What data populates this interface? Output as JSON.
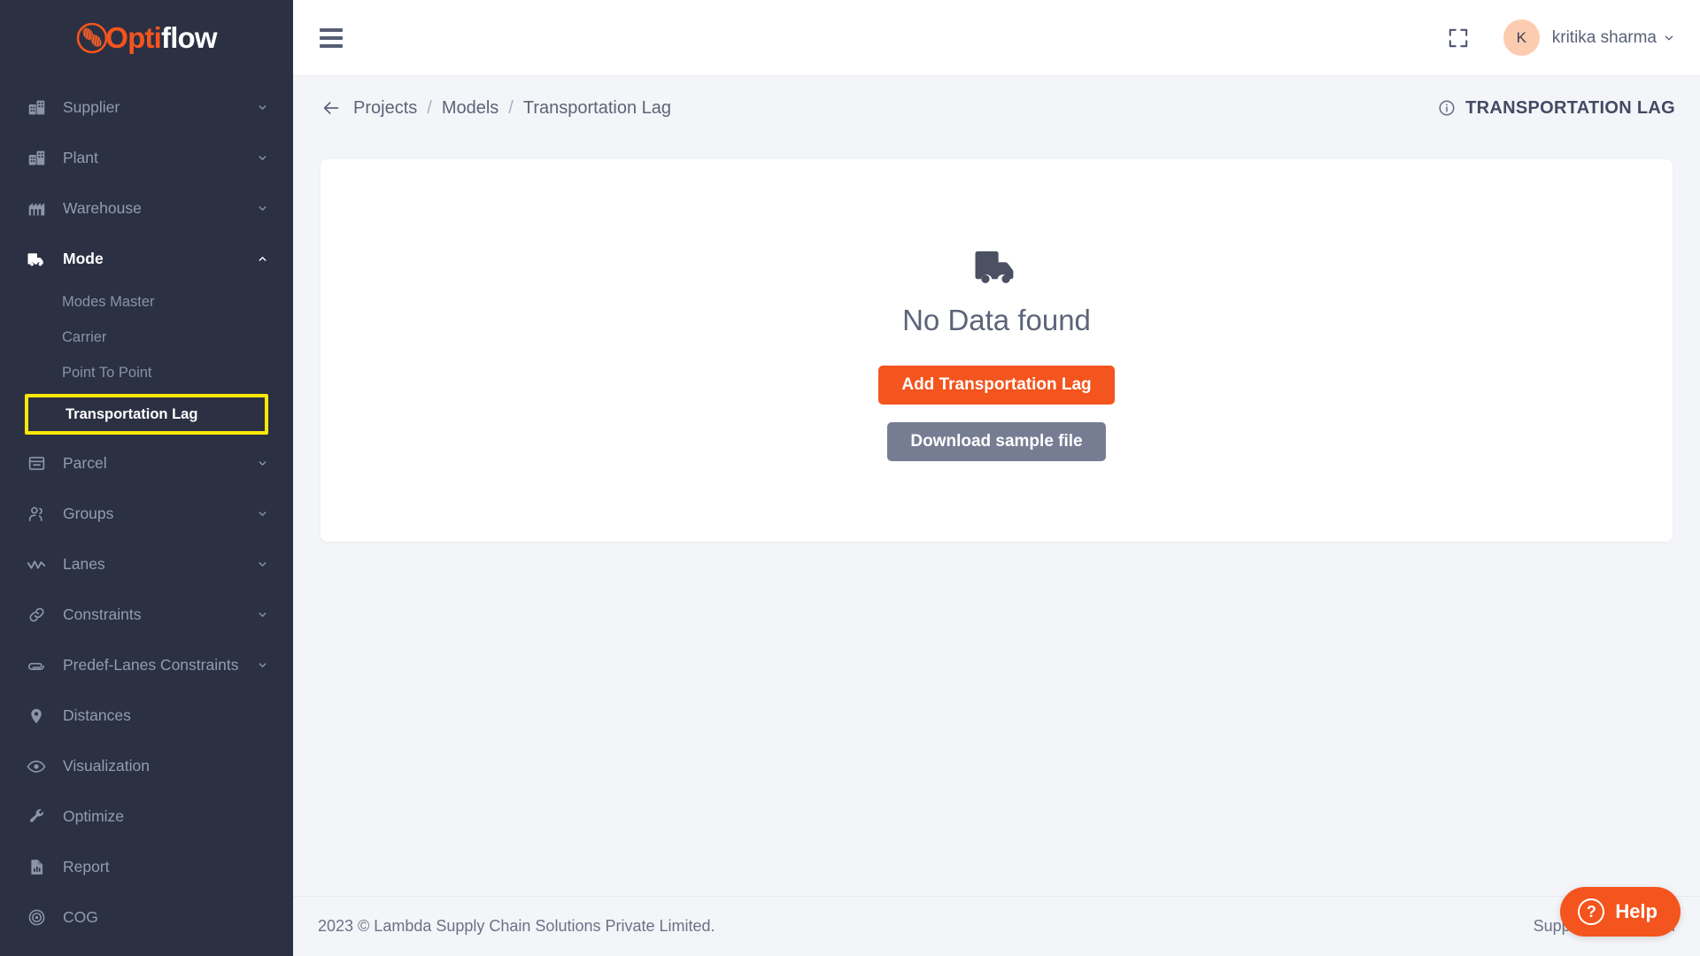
{
  "brand": {
    "logo_opti": "Opti",
    "logo_flow": "flow",
    "accent_color": "#f4541d",
    "sidebar_color": "#2b3043",
    "highlight_color": "#fbe80a"
  },
  "sidebar": {
    "items": [
      {
        "label": "Supplier",
        "icon": "factory-icon",
        "chevron": "chevron-down-icon",
        "active": false
      },
      {
        "label": "Plant",
        "icon": "factory-icon",
        "chevron": "chevron-down-icon",
        "active": false
      },
      {
        "label": "Warehouse",
        "icon": "warehouse-icon",
        "chevron": "chevron-down-icon",
        "active": false
      },
      {
        "label": "Mode",
        "icon": "truck-icon",
        "chevron": "chevron-up-icon",
        "active": true
      }
    ],
    "mode_subitems": [
      {
        "label": "Modes Master",
        "highlighted": false
      },
      {
        "label": "Carrier",
        "highlighted": false
      },
      {
        "label": "Point To Point",
        "highlighted": false
      },
      {
        "label": "Transportation Lag",
        "highlighted": true
      }
    ],
    "items_after": [
      {
        "label": "Parcel",
        "icon": "box-icon",
        "chevron": "chevron-down-icon",
        "active": false
      },
      {
        "label": "Groups",
        "icon": "users-icon",
        "chevron": "chevron-down-icon",
        "active": false
      },
      {
        "label": "Lanes",
        "icon": "zigzag-icon",
        "chevron": "chevron-down-icon",
        "active": false
      },
      {
        "label": "Constraints",
        "icon": "link-icon",
        "chevron": "chevron-down-icon",
        "active": false
      },
      {
        "label": "Predef-Lanes Constraints",
        "icon": "paperclip-icon",
        "chevron": "chevron-down-icon",
        "active": false
      },
      {
        "label": "Distances",
        "icon": "map-pin-icon",
        "chevron": "",
        "active": false
      },
      {
        "label": "Visualization",
        "icon": "eye-icon",
        "chevron": "",
        "active": false
      },
      {
        "label": "Optimize",
        "icon": "wrench-icon",
        "chevron": "",
        "active": false
      },
      {
        "label": "Report",
        "icon": "report-icon",
        "chevron": "",
        "active": false
      },
      {
        "label": "COG",
        "icon": "target-icon",
        "chevron": "",
        "active": false
      }
    ]
  },
  "topbar": {
    "menu_icon": "hamburger-icon",
    "expand_icon": "fullscreen-icon",
    "avatar_initial": "K",
    "user_name": "kritika sharma",
    "user_chevron": "chevron-down-icon"
  },
  "breadcrumb": {
    "back_icon": "arrow-left-icon",
    "items": [
      "Projects",
      "Models",
      "Transportation Lag"
    ],
    "separator": "/"
  },
  "page": {
    "info_icon": "info-circle-icon",
    "title": "TRANSPORTATION LAG"
  },
  "empty_state": {
    "icon": "truck-icon",
    "message": "No Data found",
    "primary_button": "Add Transportation Lag",
    "secondary_button": "Download sample file"
  },
  "footer": {
    "copyright": "2023 © Lambda Supply Chain Solutions Private Limited.",
    "support": "Support : support@l"
  },
  "help_widget": {
    "icon": "question-circle-icon",
    "label": "Help"
  }
}
